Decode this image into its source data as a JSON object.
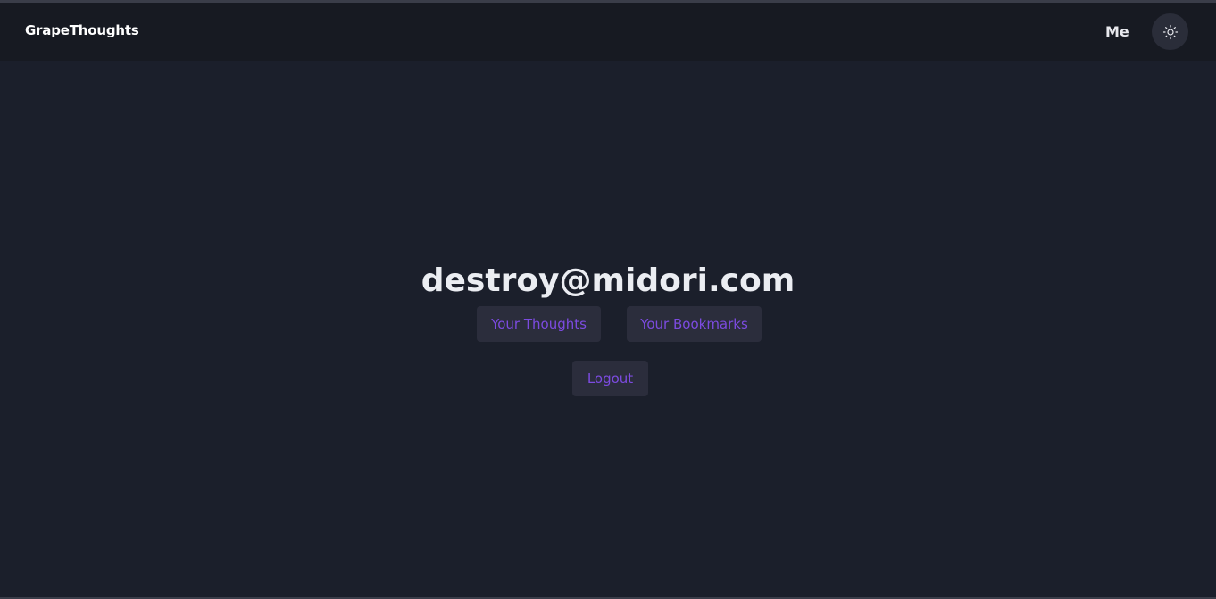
{
  "navbar": {
    "brand": "GrapeThoughts",
    "me_link": "Me",
    "theme_toggle_icon": "sun-icon"
  },
  "profile": {
    "email": "destroy@midori.com",
    "buttons": {
      "thoughts": "Your Thoughts",
      "bookmarks": "Your Bookmarks",
      "logout": "Logout"
    }
  },
  "colors": {
    "background": "#1b1f2b",
    "navbar": "#171a22",
    "button_bg": "#2b2d3c",
    "accent": "#7c4be0",
    "text": "#ebedf2"
  }
}
